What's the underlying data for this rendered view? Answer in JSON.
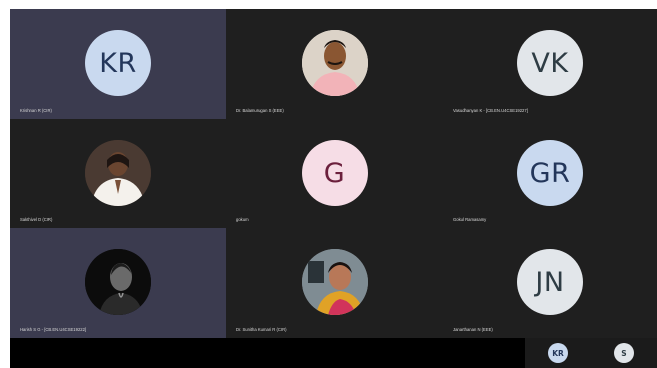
{
  "colors": {
    "tile_dark": "#1f1f1f",
    "tile_highlight": "#3b3b4f",
    "avatar_blue": "#c9d9ef",
    "avatar_blue_text": "#23365a",
    "avatar_pink": "#f6dde6",
    "avatar_pink_text": "#6b1f3c",
    "avatar_grey": "#e2e6ea",
    "avatar_grey_text": "#2e3c44",
    "tray_bg": "#000000",
    "tray_tile": "#1b1b1b"
  },
  "participants": [
    {
      "initials": "KR",
      "name": "Krishnan R (CIR)",
      "photo": ""
    },
    {
      "initials": "",
      "name": "Dr. Balamurugan S (EEE)",
      "photo": "man-portrait"
    },
    {
      "initials": "VK",
      "name": "Vasudhanyan K - [CB.EN.U4CSE19227]",
      "photo": ""
    },
    {
      "initials": "",
      "name": "Sakthivel D (CIR)",
      "photo": "amma-portrait"
    },
    {
      "initials": "G",
      "name": "gokum",
      "photo": ""
    },
    {
      "initials": "GR",
      "name": "Gokul Ramasamy",
      "photo": ""
    },
    {
      "initials": "",
      "name": "Harish S G - [CB.EN.U4CSE19222]",
      "photo": "silhouette-portrait"
    },
    {
      "initials": "",
      "name": "Dr. Sunitha Kumari R (CIR)",
      "photo": "woman-portrait"
    },
    {
      "initials": "JN",
      "name": "Janarthanan N (EEE)",
      "photo": ""
    }
  ],
  "tray": [
    {
      "initials": "KR"
    },
    {
      "initials": "S"
    }
  ]
}
